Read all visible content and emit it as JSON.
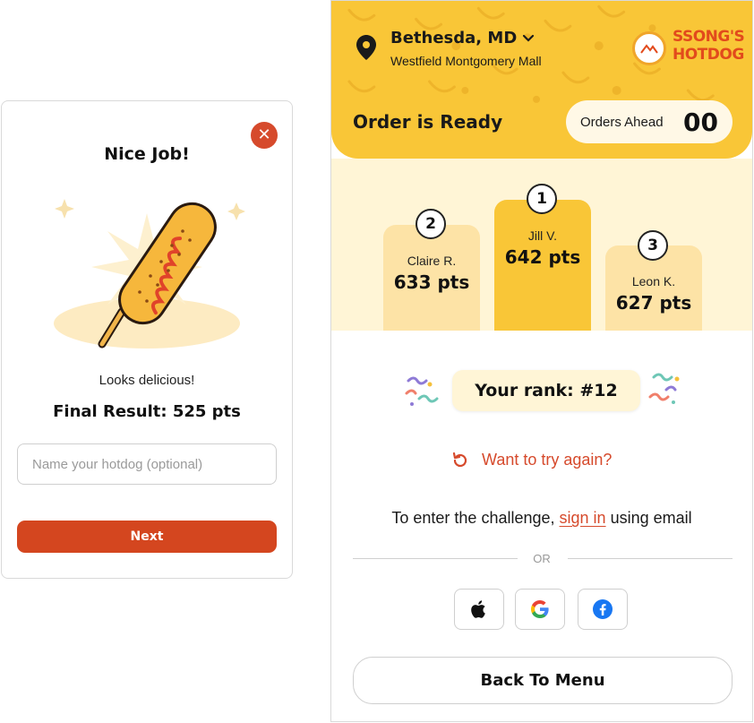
{
  "modal": {
    "title": "Nice Job!",
    "caption": "Looks delicious!",
    "result": "Final Result: 525 pts",
    "name_placeholder": "Name your hotdog (optional)",
    "next_label": "Next",
    "close_icon": "close-icon"
  },
  "location": {
    "city": "Bethesda, MD",
    "mall": "Westfield Montgomery Mall"
  },
  "brand": {
    "line1": "SSONG'S",
    "line2": "HOTDOG"
  },
  "status": {
    "title": "Order is Ready",
    "orders_ahead_label": "Orders Ahead",
    "orders_ahead_count": "00"
  },
  "leaderboard": [
    {
      "rank": "1",
      "name": "Jill V.",
      "score": "642 pts"
    },
    {
      "rank": "2",
      "name": "Claire R.",
      "score": "633 pts"
    },
    {
      "rank": "3",
      "name": "Leon K.",
      "score": "627 pts"
    }
  ],
  "your_rank": "Your rank: #12",
  "try_again": "Want to try again?",
  "challenge": {
    "prefix": "To enter the challenge,",
    "link": "sign in",
    "suffix": "using email"
  },
  "or_label": "OR",
  "social": [
    "apple-icon",
    "google-icon",
    "facebook-icon"
  ],
  "back_label": "Back To Menu",
  "colors": {
    "accent": "#d4461f",
    "header_yellow": "#f9c637",
    "podium_gold": "#f9c637",
    "podium_light": "#fde3a6",
    "cream": "#fff5d6"
  }
}
